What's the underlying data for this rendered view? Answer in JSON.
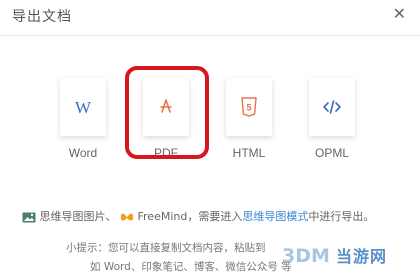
{
  "dialog": {
    "title": "导出文档",
    "close_glyph": "✕"
  },
  "formats": [
    {
      "label": "Word",
      "icon": "word-icon",
      "color": "#3c6bbf"
    },
    {
      "label": "PDF",
      "icon": "pdf-icon",
      "color": "#e8734a"
    },
    {
      "label": "HTML",
      "icon": "html5-icon",
      "color": "#e8734a"
    },
    {
      "label": "OPML",
      "icon": "code-icon",
      "color": "#3c6bbf"
    }
  ],
  "selection_color": "#d7171f",
  "note": {
    "text1": "思维导图图片、",
    "freemind": "FreeMind",
    "text2": "，需要进入",
    "link": "思维导图模式",
    "text3": "中进行导出。"
  },
  "tip": {
    "line1": "小提示：您可以直接复制文档内容，粘贴到",
    "line2": "如 Word、印象笔记、博客、微信公众号 等"
  },
  "watermark": {
    "text": "当游网"
  }
}
